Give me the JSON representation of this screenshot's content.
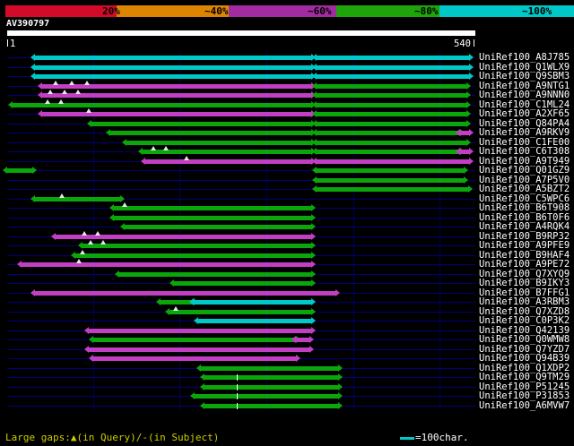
{
  "chart_data": {
    "type": "bar",
    "subtype": "sequence-alignment-coverage-map",
    "title": "AV390797",
    "x_axis": {
      "start": "1",
      "end": "540",
      "length": 540,
      "unit": "characters",
      "grid_interval": 100
    },
    "identity_scale": {
      "segments": [
        {
          "label": "20%",
          "color": "#d40a2a"
        },
        {
          "label": "~40%",
          "color": "#dd8500"
        },
        {
          "label": "~60%",
          "color": "#a22ba2"
        },
        {
          "label": "~80%",
          "color": "#1ea50a"
        },
        {
          "label": "~100%",
          "color": "#00c8c8"
        }
      ]
    },
    "palette": {
      "cyan": "#00c8c8",
      "green": "#0ba60b",
      "magenta": "#c23ec2"
    },
    "legend": {
      "gaps_text": "Large gaps:▲(in Query)/-(in Subject)",
      "ruler_text": "=100char.",
      "ruler_color": "#00c8c8"
    },
    "rows": [
      {
        "label": "UniRef100_A8J785",
        "segments": [
          {
            "from": 33,
            "to": 352,
            "color": "cyan"
          },
          {
            "from": 358,
            "to": 534,
            "color": "cyan"
          }
        ]
      },
      {
        "label": "UniRef100_Q1WLX9",
        "segments": [
          {
            "from": 33,
            "to": 352,
            "color": "cyan"
          },
          {
            "from": 358,
            "to": 534,
            "color": "cyan"
          }
        ]
      },
      {
        "label": "UniRef100_Q9SBM3",
        "segments": [
          {
            "from": 33,
            "to": 352,
            "color": "cyan"
          },
          {
            "from": 358,
            "to": 534,
            "color": "cyan"
          }
        ]
      },
      {
        "label": "UniRef100_A9NTG1",
        "segments": [
          {
            "from": 41,
            "to": 352,
            "color": "magenta"
          },
          {
            "from": 358,
            "to": 531,
            "color": "green"
          }
        ],
        "query_gaps": [
          57,
          75,
          93
        ]
      },
      {
        "label": "UniRef100_A9NNN0",
        "segments": [
          {
            "from": 41,
            "to": 352,
            "color": "magenta"
          },
          {
            "from": 358,
            "to": 531,
            "color": "green"
          }
        ],
        "query_gaps": [
          51,
          67,
          83
        ]
      },
      {
        "label": "UniRef100_C1ML24",
        "segments": [
          {
            "from": 7,
            "to": 352,
            "color": "green"
          },
          {
            "from": 358,
            "to": 531,
            "color": "green"
          }
        ],
        "query_gaps": [
          48,
          63
        ]
      },
      {
        "label": "UniRef100_A2XF65",
        "segments": [
          {
            "from": 41,
            "to": 352,
            "color": "magenta"
          },
          {
            "from": 358,
            "to": 531,
            "color": "green"
          }
        ],
        "query_gaps": [
          95
        ]
      },
      {
        "label": "UniRef100_Q84PA4",
        "segments": [
          {
            "from": 98,
            "to": 352,
            "color": "green"
          },
          {
            "from": 358,
            "to": 531,
            "color": "green"
          }
        ]
      },
      {
        "label": "UniRef100_A9RKV9",
        "segments": [
          {
            "from": 120,
            "to": 352,
            "color": "green"
          },
          {
            "from": 358,
            "to": 523,
            "color": "green"
          },
          {
            "from": 523,
            "to": 534,
            "color": "magenta"
          }
        ]
      },
      {
        "label": "UniRef100_C1FE00",
        "segments": [
          {
            "from": 139,
            "to": 352,
            "color": "green"
          },
          {
            "from": 358,
            "to": 531,
            "color": "green"
          }
        ]
      },
      {
        "label": "UniRef100_C6T308",
        "segments": [
          {
            "from": 157,
            "to": 352,
            "color": "green"
          },
          {
            "from": 358,
            "to": 523,
            "color": "green"
          },
          {
            "from": 523,
            "to": 534,
            "color": "magenta"
          }
        ],
        "query_gaps": [
          170,
          184
        ]
      },
      {
        "label": "UniRef100_A9T949",
        "segments": [
          {
            "from": 160,
            "to": 352,
            "color": "magenta"
          },
          {
            "from": 358,
            "to": 534,
            "color": "magenta"
          }
        ],
        "query_gaps": [
          208
        ]
      },
      {
        "label": "UniRef100_Q01GZ9",
        "segments": [
          {
            "from": 1,
            "to": 30,
            "color": "green"
          },
          {
            "from": 358,
            "to": 528,
            "color": "green"
          }
        ]
      },
      {
        "label": "UniRef100_A7P5V0",
        "segments": [
          {
            "from": 358,
            "to": 528,
            "color": "green"
          }
        ]
      },
      {
        "label": "UniRef100_A5BZT2",
        "segments": [
          {
            "from": 358,
            "to": 533,
            "color": "green"
          }
        ]
      },
      {
        "label": "UniRef100_C5WPC6",
        "segments": [
          {
            "from": 33,
            "to": 131,
            "color": "green"
          }
        ],
        "query_gaps": [
          64
        ]
      },
      {
        "label": "UniRef100_B6T908",
        "segments": [
          {
            "from": 124,
            "to": 352,
            "color": "green"
          }
        ],
        "query_gaps": [
          136
        ]
      },
      {
        "label": "UniRef100_B6T0F6",
        "segments": [
          {
            "from": 124,
            "to": 352,
            "color": "green"
          }
        ]
      },
      {
        "label": "UniRef100_A4RQK4",
        "segments": [
          {
            "from": 136,
            "to": 352,
            "color": "green"
          }
        ]
      },
      {
        "label": "UniRef100_B9RP32",
        "segments": [
          {
            "from": 57,
            "to": 352,
            "color": "magenta"
          }
        ],
        "query_gaps": [
          90,
          105
        ]
      },
      {
        "label": "UniRef100_A9PFE9",
        "segments": [
          {
            "from": 88,
            "to": 352,
            "color": "green"
          }
        ],
        "query_gaps": [
          97,
          112
        ]
      },
      {
        "label": "UniRef100_B9HAF4",
        "segments": [
          {
            "from": 80,
            "to": 352,
            "color": "green"
          }
        ],
        "query_gaps": [
          88
        ]
      },
      {
        "label": "UniRef100_A9PE72",
        "segments": [
          {
            "from": 18,
            "to": 352,
            "color": "magenta"
          }
        ],
        "query_gaps": [
          84
        ]
      },
      {
        "label": "UniRef100_Q7XYQ9",
        "segments": [
          {
            "from": 130,
            "to": 352,
            "color": "green"
          }
        ]
      },
      {
        "label": "UniRef100_B9IKY3",
        "segments": [
          {
            "from": 193,
            "to": 352,
            "color": "green"
          }
        ]
      },
      {
        "label": "UniRef100_B7FFG1",
        "segments": [
          {
            "from": 33,
            "to": 380,
            "color": "magenta"
          }
        ]
      },
      {
        "label": "UniRef100_A3RBM3",
        "segments": [
          {
            "from": 178,
            "to": 216,
            "color": "green"
          },
          {
            "from": 216,
            "to": 352,
            "color": "cyan"
          }
        ]
      },
      {
        "label": "UniRef100_Q7XZD8",
        "segments": [
          {
            "from": 188,
            "to": 352,
            "color": "green"
          }
        ],
        "query_gaps": [
          195
        ]
      },
      {
        "label": "UniRef100_C0P3K2",
        "segments": [
          {
            "from": 221,
            "to": 352,
            "color": "cyan"
          }
        ]
      },
      {
        "label": "UniRef100_Q42139",
        "segments": [
          {
            "from": 95,
            "to": 352,
            "color": "magenta"
          }
        ]
      },
      {
        "label": "UniRef100_Q0WMW8",
        "segments": [
          {
            "from": 100,
            "to": 334,
            "color": "green"
          },
          {
            "from": 334,
            "to": 350,
            "color": "magenta"
          }
        ]
      },
      {
        "label": "UniRef100_Q7YZD7",
        "segments": [
          {
            "from": 95,
            "to": 350,
            "color": "magenta"
          }
        ]
      },
      {
        "label": "UniRef100_Q94B39",
        "segments": [
          {
            "from": 100,
            "to": 334,
            "color": "magenta"
          }
        ]
      },
      {
        "label": "UniRef100_Q1XDP2",
        "segments": [
          {
            "from": 224,
            "to": 383,
            "color": "green"
          }
        ]
      },
      {
        "label": "UniRef100_Q9TM29",
        "segments": [
          {
            "from": 229,
            "to": 383,
            "color": "green"
          }
        ],
        "subject_gaps": [
          266
        ]
      },
      {
        "label": "UniRef100_P51245",
        "segments": [
          {
            "from": 229,
            "to": 383,
            "color": "green"
          }
        ],
        "subject_gaps": [
          266
        ]
      },
      {
        "label": "UniRef100_P31853",
        "segments": [
          {
            "from": 217,
            "to": 383,
            "color": "green"
          }
        ],
        "subject_gaps": [
          266
        ]
      },
      {
        "label": "UniRef100_A6MVW7",
        "segments": [
          {
            "from": 229,
            "to": 383,
            "color": "green"
          }
        ],
        "subject_gaps": [
          266
        ]
      }
    ]
  }
}
